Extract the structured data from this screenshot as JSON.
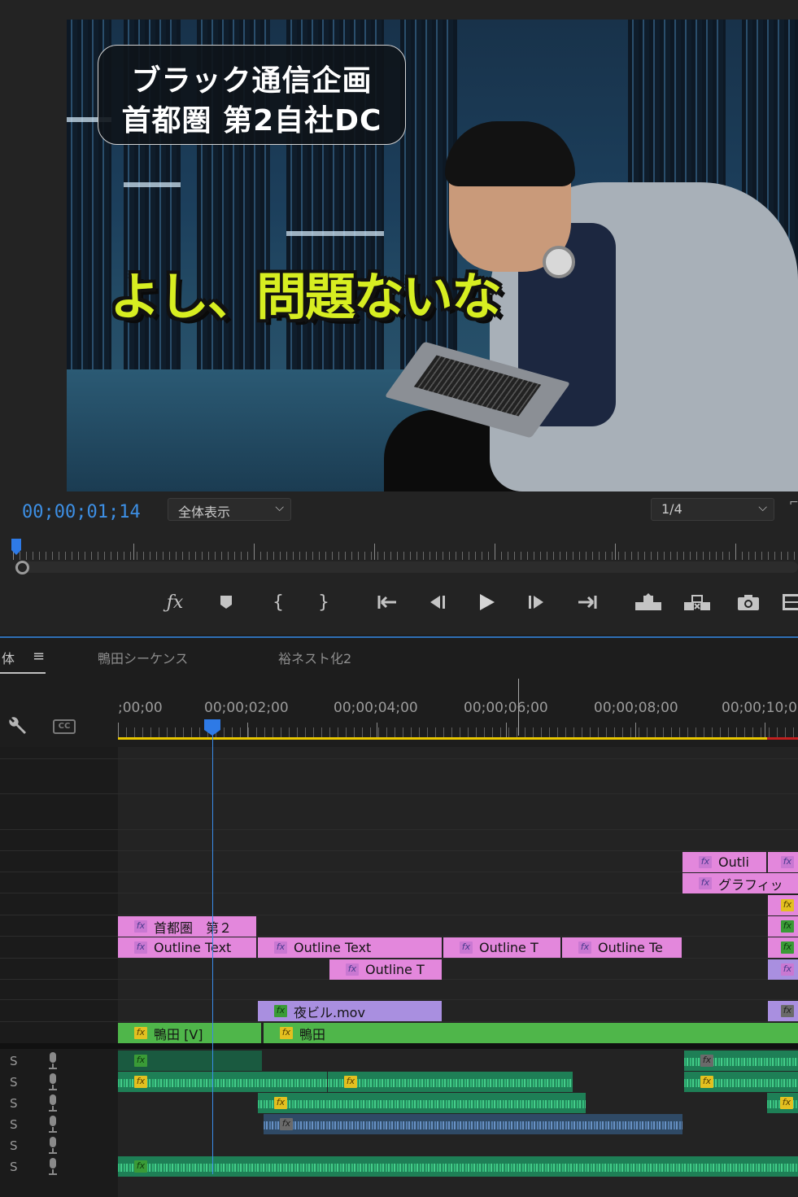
{
  "monitor": {
    "title_card": {
      "line1": "ブラック通信企画",
      "line2": "首都圏 第2自社DC"
    },
    "subtitle": "よし、問題ないな",
    "timecode": "00;00;01;14",
    "fit_dropdown": "全体表示",
    "resolution_dropdown": "1/4",
    "transport_icons": [
      "fx-icon",
      "marker-icon",
      "mark-in-icon",
      "mark-out-icon",
      "go-to-in-icon",
      "step-back-icon",
      "play-icon",
      "step-forward-icon",
      "go-to-out-icon",
      "lift-icon",
      "extract-icon",
      "camera-icon",
      "comparison-view-icon"
    ],
    "transport_glyphs": {
      "fx": "ƒx",
      "marker": "⬟",
      "in": "{",
      "out": "}",
      "goin": "{←",
      "back": "◀I",
      "play": "▶",
      "fwd": "I▶",
      "goout": "→}",
      "lift": "⏏",
      "extract": "⏏",
      "camera": "◙",
      "compare": "▤"
    }
  },
  "timeline": {
    "panel_tab": "体",
    "menu_glyph": "≡",
    "sequence_tabs": [
      "鴨田シーケンス",
      "裕ネスト化2"
    ],
    "ruler_labels": [
      ";00;00",
      "00;00;02;00",
      "00;00;04;00",
      "00;00;06;00",
      "00;00;08;00",
      "00;00;10;0"
    ],
    "icons": {
      "wrench": "🔧",
      "cc": "CC"
    },
    "audio_tracks": [
      {
        "label": "S"
      },
      {
        "label": "S"
      },
      {
        "label": "S"
      },
      {
        "label": "S"
      },
      {
        "label": "S"
      },
      {
        "label": "S"
      }
    ],
    "fx_glyph": "fx",
    "clips": {
      "v6_a": "Outli",
      "v5_a": "グラフィッ",
      "v4_a": "首都圏　第２",
      "v3_a": "Outline Text",
      "v3_b": "Outline Text",
      "v3_c": "Outline T",
      "v3_d": "Outline Te",
      "v2_a": "Outline T",
      "v1b_a": "夜ビル.mov",
      "v1_a": "鴨田 [V]",
      "v1_b": "鴨田"
    }
  },
  "colors": {
    "timecode": "#3d8fe4",
    "playhead": "#2e7ae6",
    "graphic_clip": "#e387dc",
    "video_clip_violet": "#a98fe0",
    "video_clip_green": "#4fb64a",
    "audio_clip": "#1e7f56",
    "work_area": "#e8c600"
  }
}
